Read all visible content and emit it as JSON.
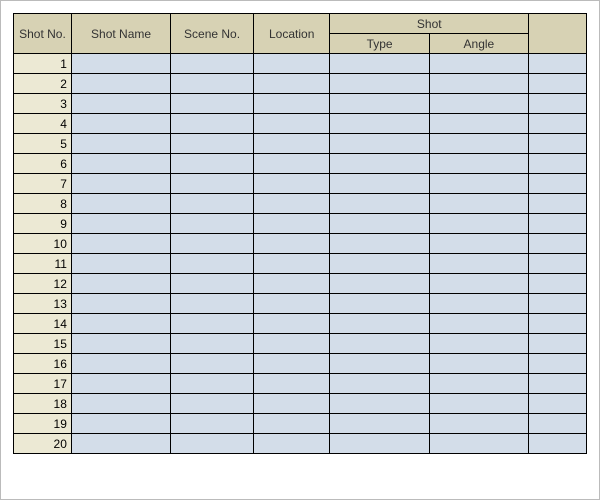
{
  "headers": {
    "shot_no": "Shot No.",
    "shot_name": "Shot Name",
    "scene_no": "Scene No.",
    "location": "Location",
    "shot_group": "Shot",
    "type": "Type",
    "angle": "Angle",
    "extra": ""
  },
  "rows": [
    {
      "no": "1",
      "name": "",
      "scene": "",
      "location": "",
      "type": "",
      "angle": "",
      "extra": ""
    },
    {
      "no": "2",
      "name": "",
      "scene": "",
      "location": "",
      "type": "",
      "angle": "",
      "extra": ""
    },
    {
      "no": "3",
      "name": "",
      "scene": "",
      "location": "",
      "type": "",
      "angle": "",
      "extra": ""
    },
    {
      "no": "4",
      "name": "",
      "scene": "",
      "location": "",
      "type": "",
      "angle": "",
      "extra": ""
    },
    {
      "no": "5",
      "name": "",
      "scene": "",
      "location": "",
      "type": "",
      "angle": "",
      "extra": ""
    },
    {
      "no": "6",
      "name": "",
      "scene": "",
      "location": "",
      "type": "",
      "angle": "",
      "extra": ""
    },
    {
      "no": "7",
      "name": "",
      "scene": "",
      "location": "",
      "type": "",
      "angle": "",
      "extra": ""
    },
    {
      "no": "8",
      "name": "",
      "scene": "",
      "location": "",
      "type": "",
      "angle": "",
      "extra": ""
    },
    {
      "no": "9",
      "name": "",
      "scene": "",
      "location": "",
      "type": "",
      "angle": "",
      "extra": ""
    },
    {
      "no": "10",
      "name": "",
      "scene": "",
      "location": "",
      "type": "",
      "angle": "",
      "extra": ""
    },
    {
      "no": "11",
      "name": "",
      "scene": "",
      "location": "",
      "type": "",
      "angle": "",
      "extra": ""
    },
    {
      "no": "12",
      "name": "",
      "scene": "",
      "location": "",
      "type": "",
      "angle": "",
      "extra": ""
    },
    {
      "no": "13",
      "name": "",
      "scene": "",
      "location": "",
      "type": "",
      "angle": "",
      "extra": ""
    },
    {
      "no": "14",
      "name": "",
      "scene": "",
      "location": "",
      "type": "",
      "angle": "",
      "extra": ""
    },
    {
      "no": "15",
      "name": "",
      "scene": "",
      "location": "",
      "type": "",
      "angle": "",
      "extra": ""
    },
    {
      "no": "16",
      "name": "",
      "scene": "",
      "location": "",
      "type": "",
      "angle": "",
      "extra": ""
    },
    {
      "no": "17",
      "name": "",
      "scene": "",
      "location": "",
      "type": "",
      "angle": "",
      "extra": ""
    },
    {
      "no": "18",
      "name": "",
      "scene": "",
      "location": "",
      "type": "",
      "angle": "",
      "extra": ""
    },
    {
      "no": "19",
      "name": "",
      "scene": "",
      "location": "",
      "type": "",
      "angle": "",
      "extra": ""
    },
    {
      "no": "20",
      "name": "",
      "scene": "",
      "location": "",
      "type": "",
      "angle": "",
      "extra": ""
    }
  ]
}
